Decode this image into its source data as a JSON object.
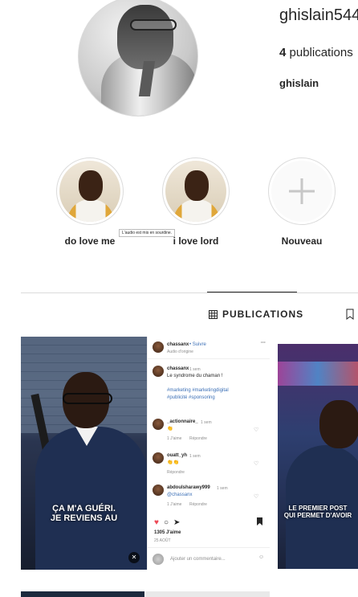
{
  "profile": {
    "username": "ghislain544",
    "publications_count": "4",
    "publications_label": "publications",
    "full_name": "ghislain"
  },
  "highlights": [
    {
      "label": "do love me"
    },
    {
      "label": "i love lord"
    },
    {
      "label": "Nouveau",
      "icon": "plus-icon"
    }
  ],
  "tabs": {
    "publications": "PUBLICATIONS",
    "publications_icon": "grid-icon",
    "saved_icon": "bookmark-icon"
  },
  "posts": {
    "post1": {
      "header_user": "chassanx",
      "follow": "• Suivre",
      "audio": "Audio d'origine",
      "caption_user": "chassanx",
      "caption_time": "1 sem",
      "caption_text": "Le syndrome du chaman !",
      "hashtags_1": "#marketing #marketingdigital",
      "hashtags_2": "#publicité #sponsoring",
      "comments": [
        {
          "user": "_actionnaire_",
          "time": "1 sem",
          "text": "👏",
          "likes": "1 J'aime",
          "reply": "Répondre"
        },
        {
          "user": "ouatt_yh",
          "time": "1 sem",
          "text": "👏👏",
          "likes": "",
          "reply": "Répondre"
        },
        {
          "user": "abdoulsharawy999",
          "time": "1 sem",
          "text": "@chassanx",
          "likes": "1 J'aime",
          "reply": "Répondre"
        }
      ],
      "likes_total": "1305 J'aime",
      "date": "25 AOÛT",
      "add_comment_placeholder": "Ajouter un commentaire...",
      "video_caption_1": "ÇA M'A GUÉRI.",
      "video_caption_2": "JE REVIENS AU",
      "muted_tooltip": "L'audio est mis en sourdine."
    },
    "post2": {
      "video_caption_1": "LE PREMIER POST",
      "video_caption_2": "QUI PERMET D'AVOIR"
    }
  }
}
